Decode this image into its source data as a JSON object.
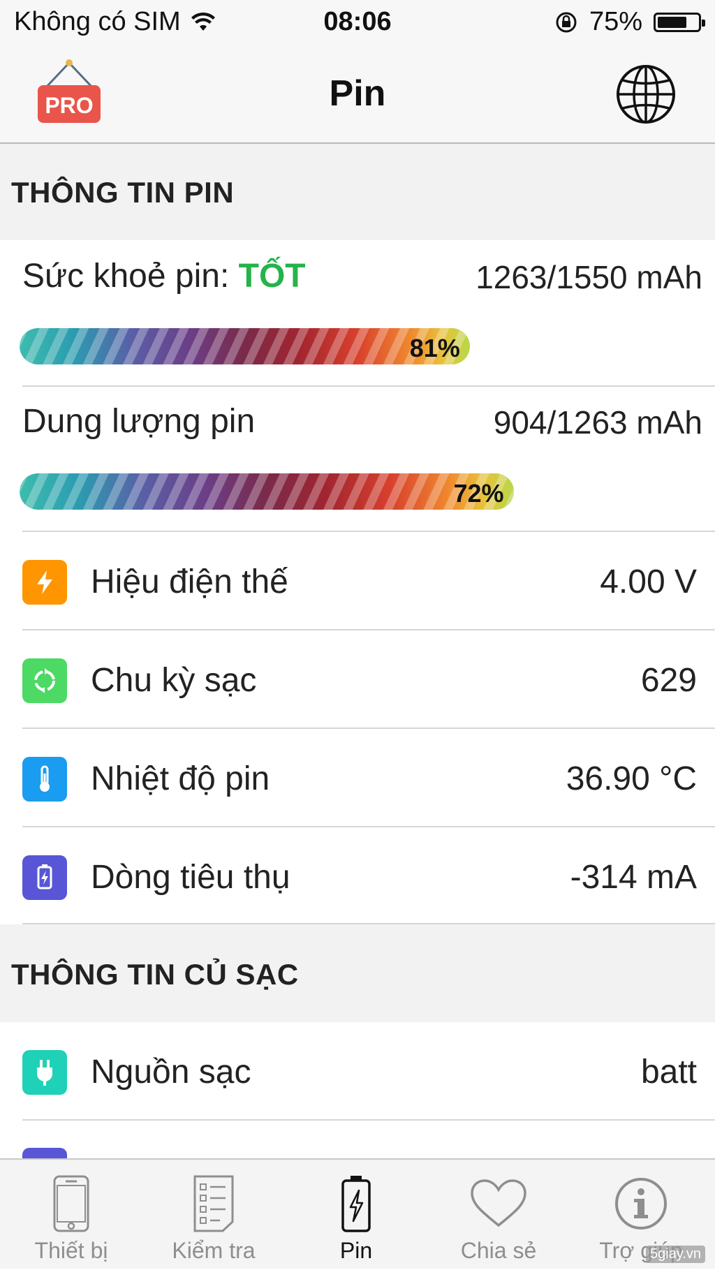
{
  "status_bar": {
    "carrier": "Không có SIM",
    "time": "08:06",
    "battery_percent": "75%",
    "battery_level": 0.75
  },
  "nav": {
    "title": "Pin",
    "pro_badge_text": "PRO"
  },
  "battery_section": {
    "header": "THÔNG TIN PIN",
    "health": {
      "label": "Sức khoẻ pin:",
      "status": "TỐT",
      "value": "1263/1550 mAh",
      "percent_text": "81%",
      "percent": 81
    },
    "capacity": {
      "label": "Dung lượng pin",
      "value": "904/1263 mAh",
      "percent_text": "72%",
      "percent": 72
    },
    "rows": [
      {
        "label": "Hiệu điện thế",
        "value": "4.00 V",
        "icon": "bolt-icon",
        "color": "#ff9500"
      },
      {
        "label": "Chu kỳ sạc",
        "value": "629",
        "icon": "cycle-icon",
        "color": "#4cd964"
      },
      {
        "label": "Nhiệt độ pin",
        "value": "36.90 °C",
        "icon": "thermometer-icon",
        "color": "#1a9cf0"
      },
      {
        "label": "Dòng tiêu thụ",
        "value": "-314 mA",
        "icon": "battery-charge-icon",
        "color": "#5856d6"
      }
    ]
  },
  "charger_section": {
    "header": "THÔNG TIN CỦ SẠC",
    "rows": [
      {
        "label": "Nguồn sạc",
        "value": "batt",
        "icon": "plug-icon",
        "color": "#1fd1b6"
      }
    ]
  },
  "tabs": [
    {
      "label": "Thiết bị",
      "icon": "phone-icon",
      "active": false
    },
    {
      "label": "Kiểm tra",
      "icon": "checklist-icon",
      "active": false
    },
    {
      "label": "Pin",
      "icon": "battery-tab-icon",
      "active": true
    },
    {
      "label": "Chia sẻ",
      "icon": "heart-icon",
      "active": false
    },
    {
      "label": "Trợ giúp",
      "icon": "info-icon",
      "active": false
    }
  ],
  "watermark": "5giay.vn"
}
